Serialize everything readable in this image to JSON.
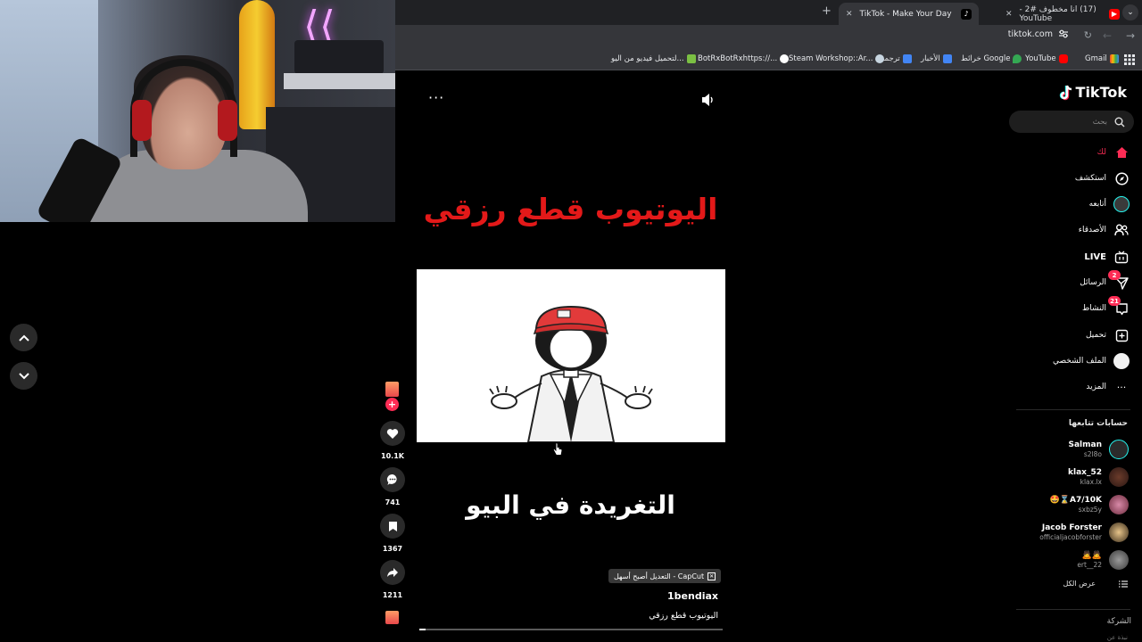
{
  "browser": {
    "tabs": [
      {
        "title": "(17) انا مخطوف #2 - YouTube",
        "active": false,
        "favicon": "youtube-icon"
      },
      {
        "title": "TikTok - Make Your Day",
        "active": true,
        "favicon": "tiktok-icon"
      }
    ],
    "url": "tiktok.com",
    "bookmarks": [
      {
        "label": "Gmail",
        "icon": "gmail-icon"
      },
      {
        "label": "YouTube",
        "icon": "youtube-icon"
      },
      {
        "label": "خرائط Google",
        "icon": "maps-icon"
      },
      {
        "label": "الأخبار",
        "icon": "news-icon"
      },
      {
        "label": "ترجمة",
        "icon": "translate-icon"
      },
      {
        "label": "Steam Workshop::Ar...",
        "icon": "steam-icon"
      },
      {
        "label": "BotRxBotRxhttps://...",
        "icon": "bot-icon"
      },
      {
        "label": "لتحميل فيديو من اليو...",
        "icon": "download-icon"
      }
    ]
  },
  "video": {
    "caption_top": "اليوتيوب قطع رزقي",
    "caption_bottom": "التغريدة في البيو",
    "effect_label": "CapCut - التعديل أصبح أسهل",
    "author": "1bendiax",
    "description": "اليوتيوب قطع رزقي",
    "progress": 0.02,
    "likes": "10.1K",
    "comments": "741",
    "saves": "1367",
    "shares": "1211"
  },
  "sidebar": {
    "logo": "TikTok",
    "search_placeholder": "بحث",
    "nav": [
      {
        "label": "لك",
        "icon": "home-icon",
        "active": true
      },
      {
        "label": "استكشف",
        "icon": "compass-icon"
      },
      {
        "label": "أتابعه",
        "icon": "following-icon"
      },
      {
        "label": "الأصدقاء",
        "icon": "friends-icon"
      },
      {
        "label": "LIVE",
        "icon": "live-icon"
      },
      {
        "label": "الرسائل",
        "icon": "send-icon",
        "badge": "2"
      },
      {
        "label": "النشاط",
        "icon": "activity-icon",
        "badge": "21"
      },
      {
        "label": "تحميل",
        "icon": "upload-icon"
      },
      {
        "label": "الملف الشخصي",
        "icon": "profile-icon"
      },
      {
        "label": "المزيد",
        "icon": "more-icon"
      }
    ],
    "following_title": "حسابات تتابعها",
    "following": [
      {
        "name": "Salman",
        "handle": "s2l8o"
      },
      {
        "name": "klax_52",
        "handle": "klax.lx"
      },
      {
        "name": "🤩⌛A7/10K",
        "handle": "sxbz5y"
      },
      {
        "name": "Jacob Forster",
        "handle": "officialjacobforster"
      },
      {
        "name": "🙇🙇",
        "handle": "ert__22"
      }
    ],
    "see_all": "عرض الكل",
    "company": "الشركة",
    "company_sub": "نبذة عن"
  },
  "colors": {
    "accent": "#fe2c55",
    "caption_red": "#e31919"
  }
}
